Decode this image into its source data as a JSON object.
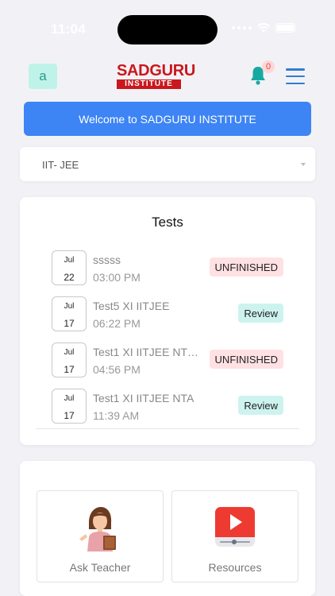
{
  "status_bar": {
    "time": "11:04"
  },
  "header": {
    "avatar_letter": "a",
    "logo_top": "SADGURU",
    "logo_bottom": "INSTITUTE",
    "notification_count": "0"
  },
  "welcome_banner": "Welcome to SADGURU INSTITUTE",
  "course_select": {
    "selected": "IIT- JEE"
  },
  "tests": {
    "title": "Tests",
    "items": [
      {
        "month": "Jul",
        "day": "22",
        "name": "sssss",
        "time": "03:00 PM",
        "status": "UNFINISHED"
      },
      {
        "month": "Jul",
        "day": "17",
        "name": "Test5 XI IITJEE",
        "time": "06:22 PM",
        "status": "Review"
      },
      {
        "month": "Jul",
        "day": "17",
        "name": "Test1 XI IITJEE NT…",
        "time": "04:56 PM",
        "status": "UNFINISHED"
      },
      {
        "month": "Jul",
        "day": "17",
        "name": "Test1 XI IITJEE NTA",
        "time": "11:39 AM",
        "status": "Review"
      }
    ]
  },
  "quick_links": {
    "ask_teacher": "Ask Teacher",
    "resources": "Resources"
  },
  "colors": {
    "primary_blue": "#3d84f5",
    "brand_red": "#c9181d",
    "unfinished_bg": "#ffe1e3",
    "review_bg": "#cdf3ef",
    "bell_teal": "#17a9a0"
  }
}
